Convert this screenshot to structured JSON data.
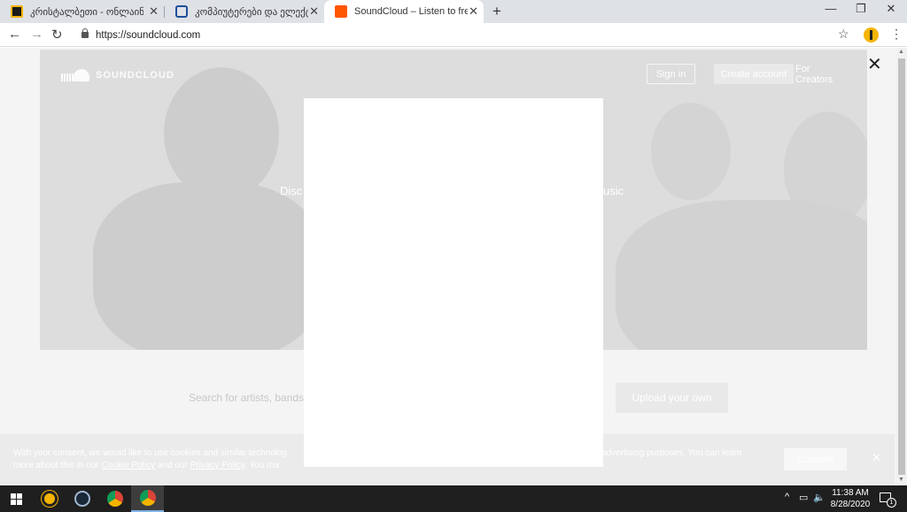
{
  "browser": {
    "tabs": [
      {
        "title": "კრისტალბეთი - ონლაინ ტოტ",
        "close": "✕"
      },
      {
        "title": "კომპიუტერები და ელექტრონ",
        "close": "✕"
      },
      {
        "title": "SoundCloud – Listen to free musi",
        "close": "✕"
      }
    ],
    "new_tab": "+",
    "window_controls": {
      "minimize": "—",
      "restore": "❐",
      "close": "✕"
    },
    "url": "https://soundcloud.com",
    "nav": {
      "back": "←",
      "forward": "→",
      "reload": "↻"
    },
    "star": "☆",
    "menu": "⋮"
  },
  "page": {
    "logo_text": "SOUNDCLOUD",
    "sign_in": "Sign in",
    "create_account": "Create account",
    "for_creators": "For Creators",
    "hero_left": "Disc",
    "hero_right": "usic",
    "search_placeholder": "Search for artists, bands",
    "upload_label": "Upload your own",
    "cookie_line1_a": "With your consent, we would like to use cookies and similar technolog",
    "cookie_line1_b": "advertising purposes. You can learn",
    "cookie_line2_a": "more about this in our ",
    "cookie_policy": "Cookie Policy",
    "cookie_line2_b": " and our ",
    "privacy_policy": "Privacy Policy",
    "cookie_line2_c": ". You ma",
    "consent_label": "Consent",
    "cookie_close": "✕",
    "modal_close": "✕"
  },
  "taskbar": {
    "time": "11:38 AM",
    "date": "8/28/2020",
    "notification_count": "1",
    "tray_caret": "^"
  },
  "colors": {
    "soundcloud_orange": "#ff5500",
    "tabstrip": "#dee1e6",
    "taskbar": "#1f1f1f"
  }
}
